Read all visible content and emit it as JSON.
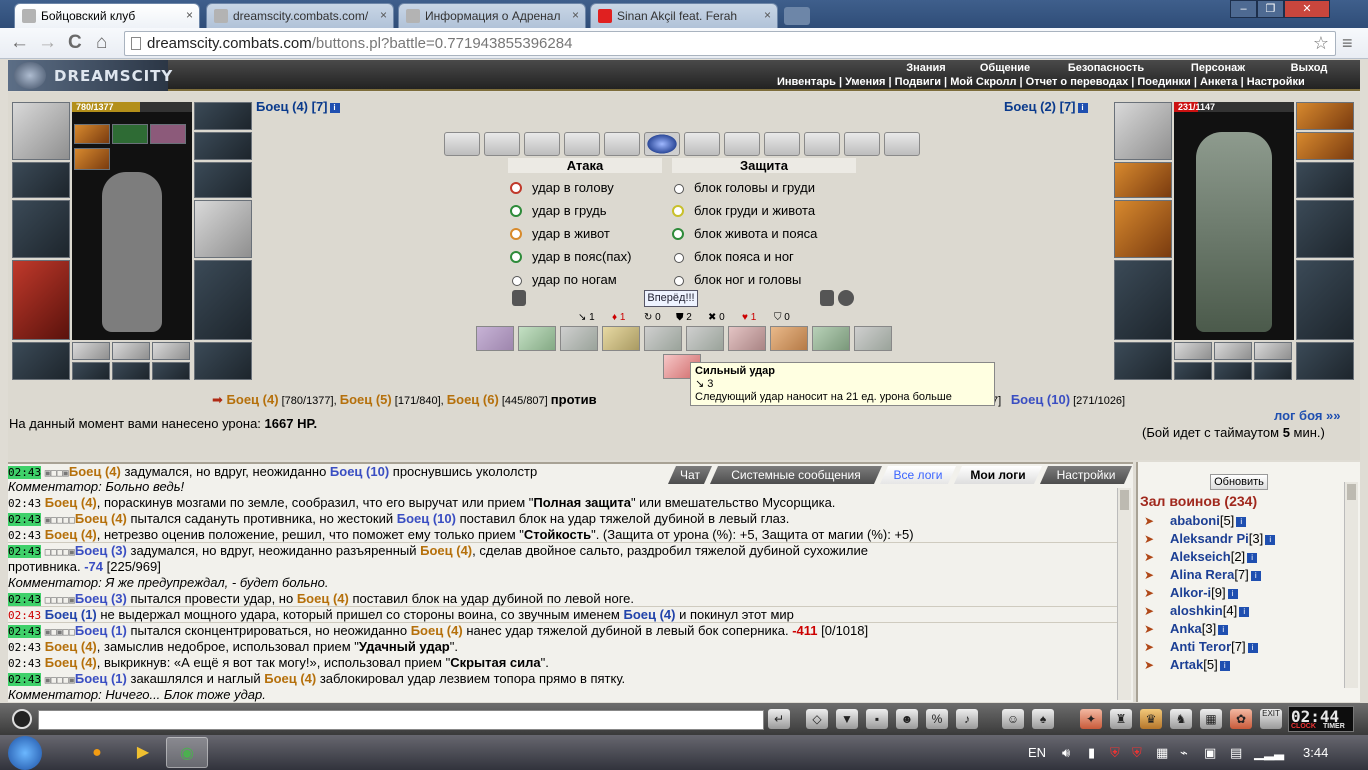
{
  "browser": {
    "tabs": [
      {
        "title": "Бойцовский клуб",
        "active": true
      },
      {
        "title": "dreamscity.combats.com/",
        "active": false
      },
      {
        "title": "Информация о Адренал",
        "active": false
      },
      {
        "title": "Sinan Akçil feat. Ferah",
        "active": false
      }
    ],
    "close_glyph": "×",
    "url_host": "dreamscity.combats.com",
    "url_path": "/buttons.pl?battle=0.771943855396284",
    "window_min": "–",
    "window_max": "❐",
    "window_close": "✕",
    "nav_back": "←",
    "nav_forward": "→",
    "nav_reload": "C",
    "nav_home": "⌂",
    "star": "☆",
    "menu": "≡"
  },
  "game": {
    "logo": "DREAMSCITY",
    "top_menu": [
      "Знания",
      "Общение",
      "Безопасность",
      "Персонаж",
      "Выход"
    ],
    "sub_menu": "Инвентарь | Умения | Подвиги | Мой Скролл | Отчет о переводах | Поединки | Анкета | Настройки"
  },
  "left_fighter": {
    "name": "Боец (4) [7]",
    "hp": "780/1377",
    "hp_fraction": 0.566
  },
  "right_fighter": {
    "name": "Боец (2) [7]",
    "hp_now": "231",
    "hp_total": "/1147",
    "hp_fraction": 0.201
  },
  "info_glyph": "i",
  "attack": {
    "title": "Атака",
    "options": [
      "удар в голову",
      "удар в грудь",
      "удар в живот",
      "удар в пояс(пах)",
      "удар по ногам"
    ]
  },
  "defense": {
    "title": "Защита",
    "options": [
      "блок головы и груди",
      "блок груди и живота",
      "блок живота и пояса",
      "блок пояса и ног",
      "блок ног и головы"
    ]
  },
  "forward_button": "Вперёд!!!",
  "stats": [
    "↘ 1",
    "♦ 1",
    "↻ 0",
    "⛊ 2",
    "✖ 0",
    "♥ 1",
    "⛉ 0"
  ],
  "tooltip": {
    "title": "Сильный удар",
    "count": "↘ 3",
    "text": "Следующий удар наносит на 21 ед. урона больше"
  },
  "fighters_line": {
    "arrow": "➡",
    "f1": "Боец (4)",
    "f1hp": " [780/1377], ",
    "f2": "Боец (5)",
    "f2hp": " [171/840], ",
    "f3": "Боец (6)",
    "f3hp": " [445/807] ",
    "vs": "против",
    "f4hp": "7]",
    "f5": "Боец (10)",
    "f5hp": " [271/1026]"
  },
  "damage_line": {
    "text": "На данный момент вами нанесено урона: ",
    "value": "1667 HP."
  },
  "log_link": "лог боя »»",
  "timeout": {
    "pre": "(Бой идет с таймаутом ",
    "value": "5",
    "post": " мин.)"
  },
  "chat_tabs": [
    "Чат",
    "Системные сообщения",
    "Все логи",
    "Мои логи",
    "Настройки"
  ],
  "chat": [
    {
      "ts": "02:43",
      "sq": "▣□□▣",
      "parts": [
        [
          "o",
          "Боец (4)"
        ],
        [
          "t",
          " задумался, но вдруг, неожиданно "
        ],
        [
          "b",
          "Боец (10)"
        ],
        [
          "t",
          " проснувшись укололстр"
        ]
      ]
    },
    {
      "ts": "",
      "sq": "",
      "parts": [
        [
          "i",
          "Комментатор: Больно ведь!"
        ]
      ]
    },
    {
      "ts": "02:43",
      "sq": "",
      "parts": [
        [
          "o",
          "Боец (4)"
        ],
        [
          "t",
          ", пораскинув мозгами по земле, сообразил, что его выручат или прием \""
        ],
        [
          "k",
          "Полная защита"
        ],
        [
          "t",
          "\" или вмешательство Мусорщика."
        ]
      ]
    },
    {
      "ts": "02:43",
      "sq": "▣□□□□",
      "parts": [
        [
          "o",
          "Боец (4)"
        ],
        [
          "t",
          " пытался садануть противника, но жестокий "
        ],
        [
          "b",
          "Боец (10)"
        ],
        [
          "t",
          " поставил блок на удар тяжелой дубиной в левый глаз."
        ]
      ]
    },
    {
      "ts": "02:43",
      "sq": "",
      "parts": [
        [
          "o",
          "Боец (4)"
        ],
        [
          "t",
          ", нетрезво оценив положение, решил, что поможет ему только прием \""
        ],
        [
          "k",
          "Стойкость"
        ],
        [
          "t",
          "\". (Защита от урона (%): +5, Защита от магии (%): +5)"
        ]
      ]
    },
    {
      "ts": "02:43",
      "sq": "□□□□▣",
      "parts": [
        [
          "b",
          "Боец (3)"
        ],
        [
          "t",
          " задумался, но вдруг, неожиданно разъяренный "
        ],
        [
          "o",
          "Боец (4)"
        ],
        [
          "t",
          ", сделав двойное сальто, раздробил тяжелой дубиной сухожилие"
        ]
      ]
    },
    {
      "ts": "",
      "sq": "",
      "parts": [
        [
          "t",
          "противника. "
        ],
        [
          "v",
          "-74"
        ],
        [
          "t",
          " [225/969]"
        ]
      ]
    },
    {
      "ts": "",
      "sq": "",
      "parts": [
        [
          "i",
          "Комментатор: Я же предупреждал, - будет больно."
        ]
      ]
    },
    {
      "ts": "02:43",
      "sq": "□□□□▣",
      "parts": [
        [
          "b",
          "Боец (3)"
        ],
        [
          "t",
          " пытался провести удар, но "
        ],
        [
          "o",
          "Боец (4)"
        ],
        [
          "t",
          " поставил блок на удар дубиной по левой ноге."
        ]
      ]
    },
    {
      "ts": "02:43",
      "sq": "",
      "parts": [
        [
          "l",
          "Боец (1)"
        ],
        [
          "t",
          " не выдержал мощного удара, который пришел со стороны воина, со звучным именем "
        ],
        [
          "l",
          "Боец (4)"
        ],
        [
          "t",
          " и покинул этот мир"
        ]
      ]
    },
    {
      "ts": "02:43",
      "sq": "▣□▣□□",
      "parts": [
        [
          "b",
          "Боец (1)"
        ],
        [
          "t",
          " пытался сконцентрироваться, но неожиданно "
        ],
        [
          "o",
          "Боец (4)"
        ],
        [
          "t",
          " нанес удар тяжелой дубиной в левый бок соперника. "
        ],
        [
          "d",
          "-411"
        ],
        [
          "t",
          " [0/1018]"
        ]
      ]
    },
    {
      "ts": "02:43",
      "sq": "",
      "parts": [
        [
          "o",
          "Боец (4)"
        ],
        [
          "t",
          ", замыслив недоброе, использовал прием \""
        ],
        [
          "k",
          "Удачный удар"
        ],
        [
          "t",
          "\"."
        ]
      ]
    },
    {
      "ts": "02:43",
      "sq": "",
      "parts": [
        [
          "o",
          "Боец (4)"
        ],
        [
          "t",
          ", выкрикнув: «А ещё я вот так могу!», использовал прием \""
        ],
        [
          "k",
          "Скрытая сила"
        ],
        [
          "t",
          "\"."
        ]
      ]
    },
    {
      "ts": "02:43",
      "sq": "▣□□□▣",
      "parts": [
        [
          "b",
          "Боец (1)"
        ],
        [
          "t",
          " закашлялся и наглый "
        ],
        [
          "o",
          "Боец (4)"
        ],
        [
          "t",
          " заблокировал удар лезвием топора прямо в пятку."
        ]
      ]
    },
    {
      "ts": "",
      "sq": "",
      "parts": [
        [
          "i",
          "Комментатор: Ничего... Блок тоже удар."
        ]
      ]
    }
  ],
  "right_panel": {
    "refresh": "Обновить",
    "title": "Зал воинов (234)",
    "players": [
      {
        "name": "ababoni",
        "lvl": "[5]"
      },
      {
        "name": "Aleksandr Pi",
        "lvl": "[3]"
      },
      {
        "name": "Alekseich",
        "lvl": "[2]"
      },
      {
        "name": "Alina Rera",
        "lvl": "[7]"
      },
      {
        "name": "Alkor-i",
        "lvl": "[9]"
      },
      {
        "name": "aloshkin",
        "lvl": "[4]"
      },
      {
        "name": "Anka",
        "lvl": "[3]"
      },
      {
        "name": "Anti Teror",
        "lvl": "[7]"
      },
      {
        "name": "Artak",
        "lvl": "[5]"
      }
    ]
  },
  "bottom": {
    "clock": "02:44",
    "clock_label": "CLOCK",
    "timer_label": "TIMER",
    "exit": "EXIT"
  },
  "taskbar": {
    "lang": "EN",
    "time": "3:44"
  }
}
